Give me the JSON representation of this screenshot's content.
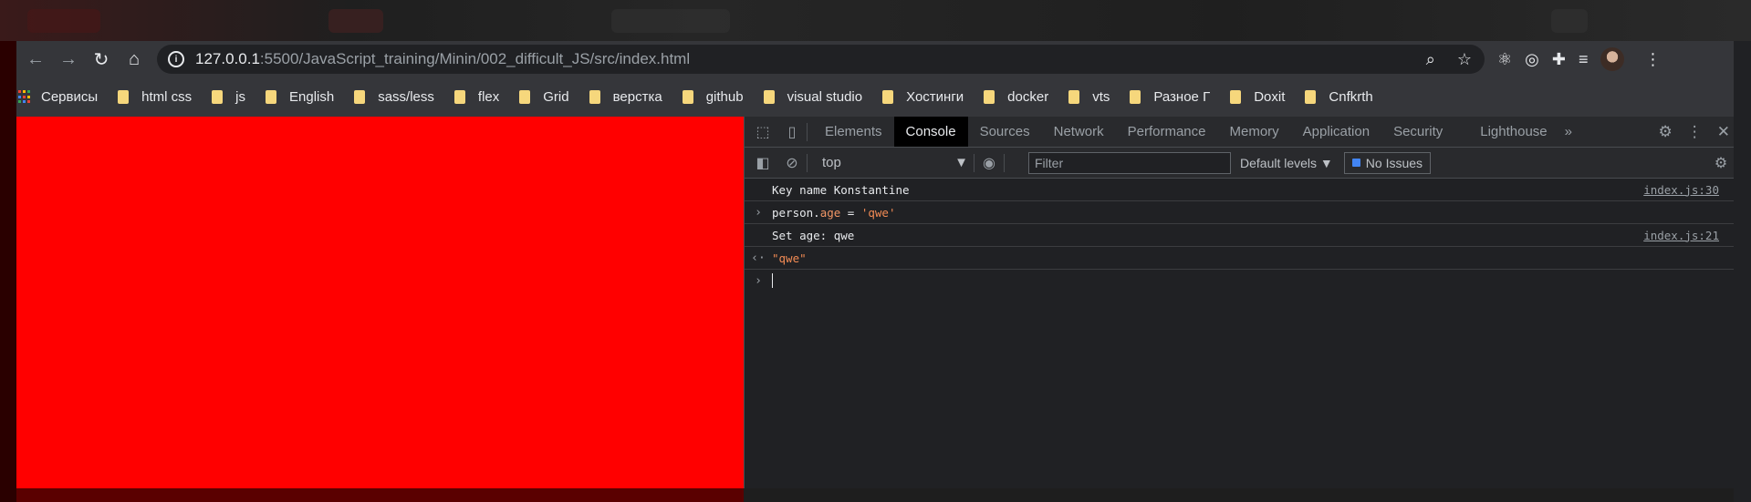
{
  "address_bar": {
    "host": "127.0.0.1",
    "path": ":5500/JavaScript_training/Minin/002_difficult_JS/src/index.html"
  },
  "bookmarks": {
    "apps_label": "Сервисы",
    "items": [
      "html css",
      "js",
      "English",
      "sass/less",
      "flex",
      "Grid",
      "верстка",
      "github",
      "visual studio",
      "Хостинги",
      "docker",
      "vts",
      "Разное Г",
      "Doxit",
      "Cnfkrth"
    ],
    "apps_colors": [
      "#ea4335",
      "#fbbc04",
      "#34a853",
      "#4285f4",
      "#ea4335",
      "#fbbc04",
      "#34a853",
      "#4285f4",
      "#ea4335"
    ]
  },
  "page": {
    "background": "#ff0000"
  },
  "devtools": {
    "tabs": [
      "Elements",
      "Console",
      "Sources",
      "Network",
      "Performance",
      "Memory",
      "Application",
      "Security",
      "Lighthouse"
    ],
    "selected_tab": "Console",
    "more_tabs": "»",
    "console_toolbar": {
      "context": "top",
      "filter_placeholder": "Filter",
      "levels": "Default levels",
      "issues": "No Issues"
    },
    "console_lines": [
      {
        "kind": "log",
        "text": "Key name Konstantine",
        "source": "index.js:30"
      },
      {
        "kind": "input",
        "object": "person",
        "prop": "age",
        "op": " = ",
        "value": "'qwe'"
      },
      {
        "kind": "log",
        "text": "Set age: qwe",
        "source": "index.js:21"
      },
      {
        "kind": "result",
        "value": "\"qwe\""
      }
    ]
  }
}
